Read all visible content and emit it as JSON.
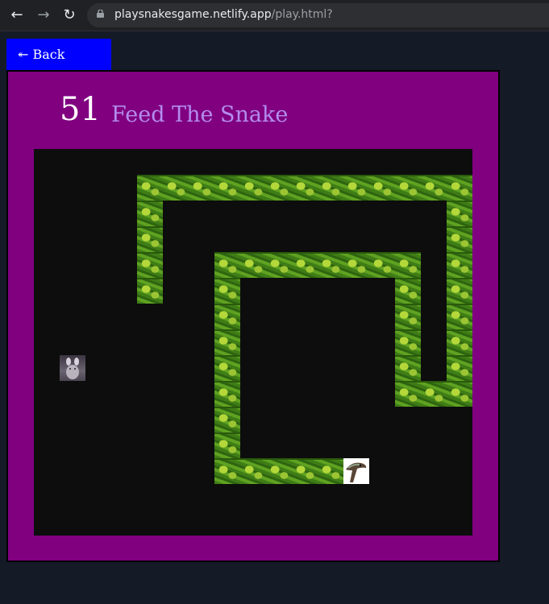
{
  "browser": {
    "url_host": "playsnakesgame.netlify.app",
    "url_path": "/play.html?"
  },
  "back_button": {
    "label": "↞ Back"
  },
  "game": {
    "score": "51",
    "title": "Feed The Snake",
    "grid": {
      "cols": 17,
      "rows": 15
    },
    "snake_body": [
      [
        4,
        1
      ],
      [
        5,
        1
      ],
      [
        6,
        1
      ],
      [
        7,
        1
      ],
      [
        8,
        1
      ],
      [
        9,
        1
      ],
      [
        10,
        1
      ],
      [
        11,
        1
      ],
      [
        12,
        1
      ],
      [
        13,
        1
      ],
      [
        14,
        1
      ],
      [
        15,
        1
      ],
      [
        16,
        1
      ],
      [
        4,
        2
      ],
      [
        16,
        2
      ],
      [
        4,
        3
      ],
      [
        16,
        3
      ],
      [
        4,
        4
      ],
      [
        7,
        4
      ],
      [
        8,
        4
      ],
      [
        9,
        4
      ],
      [
        10,
        4
      ],
      [
        11,
        4
      ],
      [
        12,
        4
      ],
      [
        13,
        4
      ],
      [
        14,
        4
      ],
      [
        16,
        4
      ],
      [
        4,
        5
      ],
      [
        7,
        5
      ],
      [
        14,
        5
      ],
      [
        16,
        5
      ],
      [
        7,
        6
      ],
      [
        14,
        6
      ],
      [
        16,
        6
      ],
      [
        7,
        7
      ],
      [
        14,
        7
      ],
      [
        16,
        7
      ],
      [
        7,
        8
      ],
      [
        14,
        8
      ],
      [
        16,
        8
      ],
      [
        7,
        9
      ],
      [
        14,
        9
      ],
      [
        15,
        9
      ],
      [
        16,
        9
      ],
      [
        7,
        10
      ],
      [
        7,
        11
      ],
      [
        7,
        12
      ],
      [
        8,
        12
      ],
      [
        9,
        12
      ],
      [
        10,
        12
      ],
      [
        11,
        12
      ]
    ],
    "snake_head": [
      12,
      12
    ],
    "food": [
      1,
      8
    ]
  }
}
